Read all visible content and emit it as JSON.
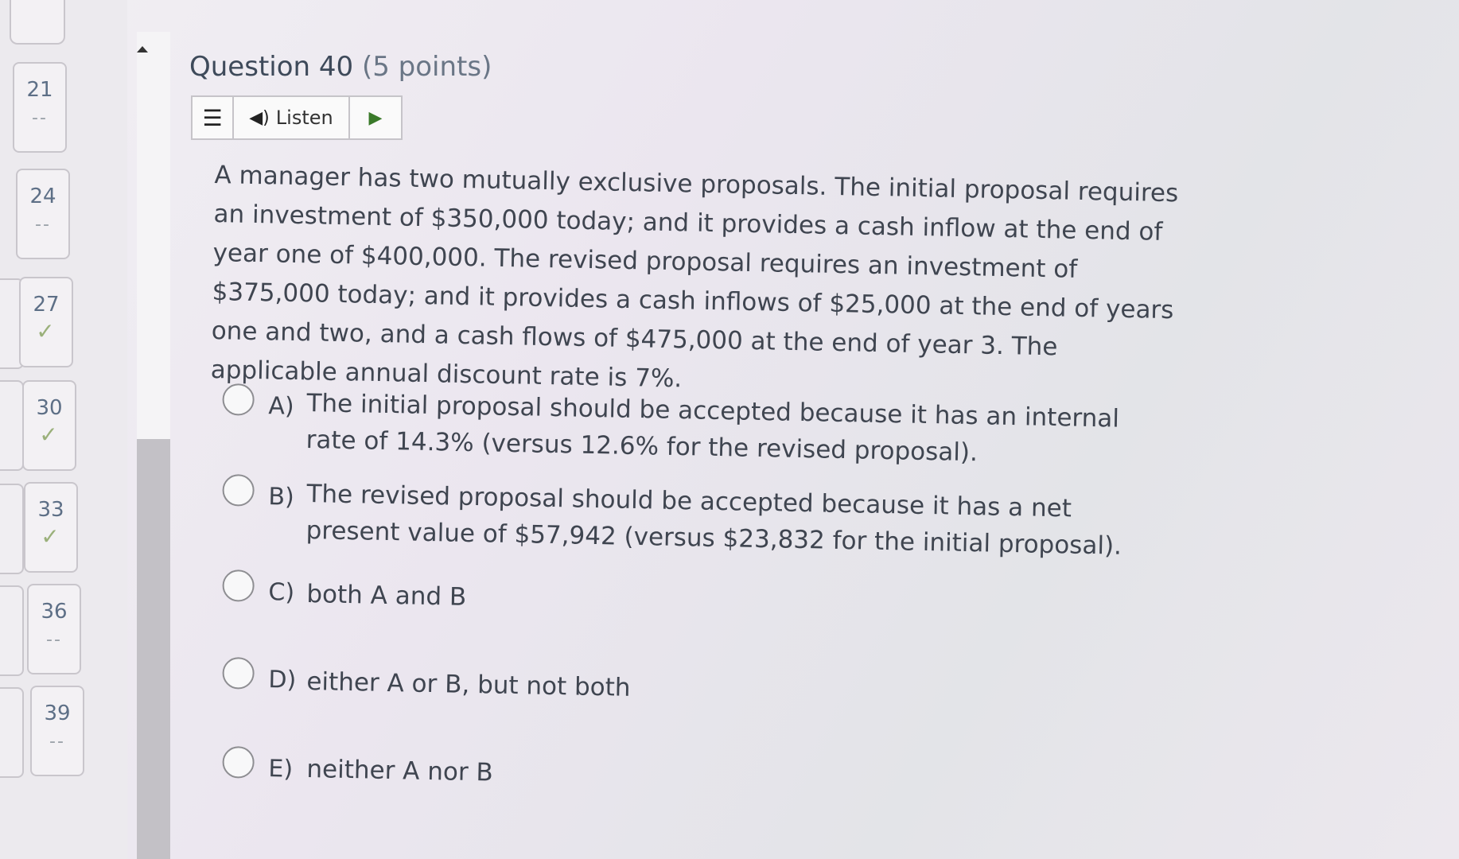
{
  "nav": {
    "questions": [
      {
        "number": "21",
        "status": "--"
      },
      {
        "number": "24",
        "status": "--"
      },
      {
        "number": "27",
        "status": "✓"
      },
      {
        "number": "30",
        "status": "✓"
      },
      {
        "number": "33",
        "status": "✓"
      },
      {
        "number": "36",
        "status": "--"
      },
      {
        "number": "39",
        "status": "--"
      }
    ]
  },
  "question": {
    "title": "Question 40",
    "points": "(5 points)",
    "listen_label": "Listen",
    "text": "A manager has two mutually exclusive proposals. The initial proposal requires an investment of $350,000 today; and it provides a cash inflow at the end of year one of $400,000. The revised proposal requires an investment of $375,000 today; and it provides a cash inflows of $25,000 at the end of years one and two, and a cash flows of $475,000 at the end of year 3. The applicable annual discount rate is 7%.",
    "options": [
      {
        "letter": "A)",
        "text": "The initial proposal should be accepted because it has an internal rate of 14.3% (versus 12.6% for the revised proposal)."
      },
      {
        "letter": "B)",
        "text": "The revised proposal should be accepted because it has a net present value of $57,942 (versus $23,832 for the initial proposal)."
      },
      {
        "letter": "C)",
        "text": "both A and B"
      },
      {
        "letter": "D)",
        "text": "either A or B, but not both"
      },
      {
        "letter": "E)",
        "text": "neither A nor B"
      }
    ]
  }
}
